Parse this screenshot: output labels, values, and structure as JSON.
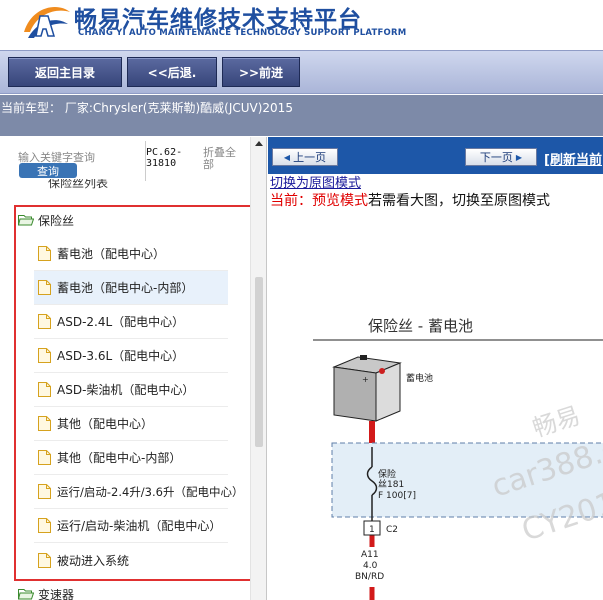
{
  "header": {
    "title": "畅易汽车维修技术支持平台",
    "subtitle": "CHANG YI AUTO MAINTENANCE TECHNOLOGY SUPPORT PLATFORM"
  },
  "toolbar": {
    "home_label": "返回主目录",
    "back_label": "<<后退.",
    "forward_label": ">>前进"
  },
  "car_info": "当前车型： 厂家:Chrysler(克莱斯勒)酷威(JCUV)2015",
  "left_pane": {
    "search_placeholder": "输入关键字查询",
    "search_button": "查询",
    "pc_code_line1": "PC.62-",
    "pc_code_line2": "31810",
    "collapse_line1": "折叠全",
    "collapse_line2": "部",
    "cut_item": "保险丝列表",
    "folder_fuse": "保险丝",
    "folder_trans": "变速器",
    "items": [
      {
        "label": "蓄电池（配电中心）"
      },
      {
        "label": "蓄电池（配电中心-内部）"
      },
      {
        "label": "ASD-2.4L（配电中心）"
      },
      {
        "label": "ASD-3.6L（配电中心）"
      },
      {
        "label": "ASD-柴油机（配电中心）"
      },
      {
        "label": "其他（配电中心）"
      },
      {
        "label": "其他（配电中心-内部）"
      },
      {
        "label": "运行/启动-2.4升/3.6升（配电中心）"
      },
      {
        "label": "运行/启动-柴油机（配电中心）"
      },
      {
        "label": "被动进入系统"
      }
    ]
  },
  "right_pane": {
    "prev_page": "上一页",
    "next_page": "下一页",
    "refresh": "[刷新当前",
    "original_link": "切换为原图模式",
    "preview_prefix": "当前：",
    "preview_mode": "预览模式",
    "preview_suffix": "若需看大图，切换至原图模式"
  },
  "diagram": {
    "title": "保险丝 - 蓄电池",
    "battery_label": "蓄电池",
    "fuse_line1": "保险",
    "fuse_line2": "丝181",
    "fuse_line3": "F 100[7]",
    "connector_pin": "1",
    "connector_name": "C2",
    "wire_id": "A11",
    "wire_gauge": "4.0",
    "wire_color": "BN/RD",
    "watermark1": "畅易",
    "watermark2": "car388.c",
    "watermark3": "CY201"
  },
  "colors": {
    "brand_blue": "#1f4fa0",
    "nav_blue": "#1d57a8",
    "highlight_red": "#e03030",
    "wire_red": "#d21a1a"
  }
}
